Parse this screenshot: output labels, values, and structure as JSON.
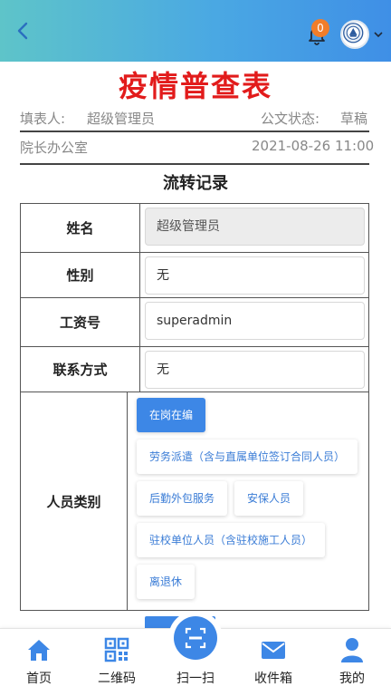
{
  "header": {
    "back_icon": "chevron-left-icon",
    "bell_icon": "bell-icon",
    "notification_count": "0",
    "avatar_icon": "emblem-avatar-icon",
    "dropdown_icon": "chevron-down-icon"
  },
  "document": {
    "title": "疫情普查表",
    "filler_label": "填表人:",
    "filler_name": "超级管理员",
    "status_label": "公文状态:",
    "status_value": "草稿",
    "department": "院长办公室",
    "datetime": "2021-08-26 11:00"
  },
  "section": {
    "title": "流转记录"
  },
  "form": {
    "name_label": "姓名",
    "name_value": "超级管理员",
    "gender_label": "性别",
    "gender_value": "无",
    "staff_id_label": "工资号",
    "staff_id_value": "superadmin",
    "contact_label": "联系方式",
    "contact_value": "无",
    "category_label": "人员类别",
    "categories": [
      {
        "label": "在岗在编",
        "selected": true
      },
      {
        "label": "劳务派遣（含与直属单位签订合同人员）",
        "selected": false
      },
      {
        "label": "后勤外包服务",
        "selected": false
      },
      {
        "label": "安保人员",
        "selected": false
      },
      {
        "label": "驻校单位人员（含驻校施工人员）",
        "selected": false
      },
      {
        "label": "离退休",
        "selected": false
      }
    ]
  },
  "bottom_nav": [
    {
      "label": "首页",
      "icon": "home-icon"
    },
    {
      "label": "二维码",
      "icon": "qr-code-icon"
    },
    {
      "label": "扫一扫",
      "icon": "scan-icon"
    },
    {
      "label": "收件箱",
      "icon": "mail-icon"
    },
    {
      "label": "我的",
      "icon": "user-icon"
    }
  ],
  "colors": {
    "header_gradient_start": "#5ec4c9",
    "header_gradient_end": "#3f8fe6",
    "title_red": "#e21b1b",
    "accent_blue": "#3d87e6",
    "badge_orange": "#f07d2a"
  }
}
